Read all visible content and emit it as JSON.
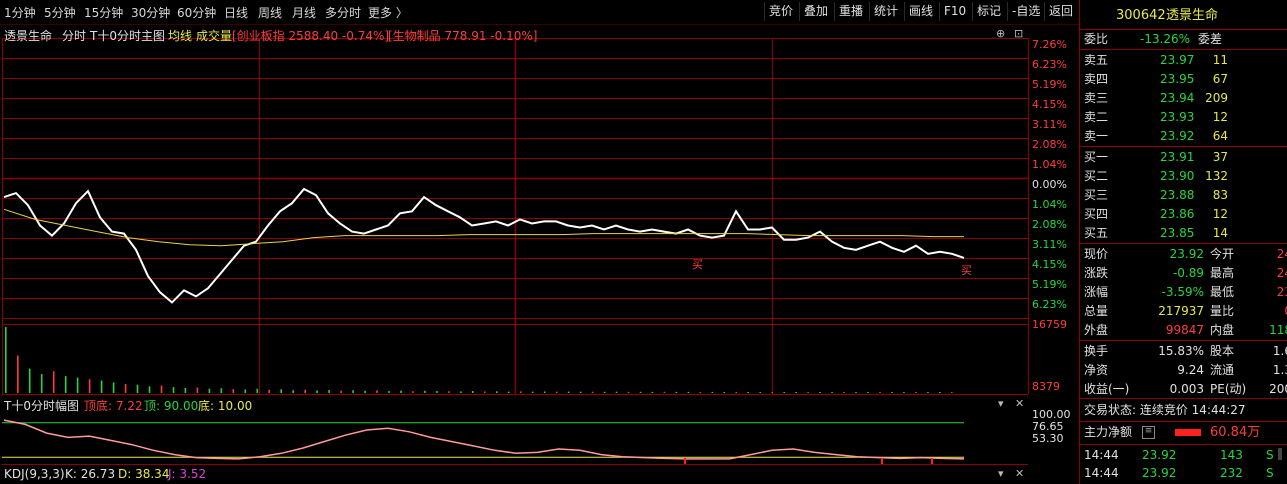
{
  "toolbar": {
    "periods": [
      "1分钟",
      "5分钟",
      "15分钟",
      "30分钟",
      "60分钟",
      "日线",
      "周线",
      "月线",
      "多分时",
      "更多 〉"
    ],
    "buttons": [
      "竞价",
      "叠加",
      "重播",
      "统计",
      "画线",
      "F10",
      "标记",
      "-自选",
      "返回"
    ]
  },
  "header": {
    "stock_name": "透景生命",
    "mode": "分时",
    "sub_mode": "T十0分时主图",
    "avg_label": "均线",
    "vol_label": "成交量",
    "board1": "[创业板指 2588.40 -0.74%]",
    "board2": "[生物制品 778.91 -0.10%]"
  },
  "chart_data": [
    {
      "type": "line",
      "pct_ticks_red": [
        "7.26%",
        "6.23%",
        "5.19%",
        "4.15%",
        "3.11%",
        "2.08%",
        "1.04%"
      ],
      "pct_zero": "0.00%",
      "pct_ticks_green": [
        "1.04%",
        "2.08%",
        "3.11%",
        "4.15%",
        "5.19%",
        "6.23%"
      ],
      "series": [
        {
          "role": "price",
          "values": [
            -0.6,
            -0.4,
            -1.0,
            -2.0,
            -2.5,
            -1.9,
            -0.9,
            -0.3,
            -1.6,
            -2.3,
            -2.4,
            -3.2,
            -4.5,
            -5.3,
            -5.8,
            -5.2,
            -5.5,
            -5.1,
            -4.4,
            -3.7,
            -3.0,
            -2.8,
            -2.0,
            -1.3,
            -0.9,
            -0.2,
            -0.5,
            -1.4,
            -1.9,
            -2.3,
            -2.4,
            -2.2,
            -2.0,
            -1.4,
            -1.3,
            -0.6,
            -1.0,
            -1.3,
            -1.6,
            -2.0,
            -1.9,
            -1.8,
            -2.0,
            -1.7,
            -1.9,
            -1.8,
            -1.8,
            -2.0,
            -2.1,
            -2.0,
            -2.2,
            -2.0,
            -2.2,
            -2.3,
            -2.2,
            -2.3,
            -2.4,
            -2.2,
            -2.5,
            -2.6,
            -2.5,
            -1.3,
            -2.2,
            -2.2,
            -2.1,
            -2.7,
            -2.7,
            -2.6,
            -2.3,
            -2.8,
            -3.1,
            -3.2,
            -3.0,
            -2.8,
            -3.1,
            -3.3,
            -3.0,
            -3.4,
            -3.3,
            -3.4,
            -3.6
          ]
        },
        {
          "role": "avg",
          "values": [
            -1.2,
            -1.7,
            -2.0,
            -2.3,
            -2.6,
            -2.8,
            -2.95,
            -3.0,
            -2.9,
            -2.8,
            -2.6,
            -2.5,
            -2.5,
            -2.5,
            -2.5,
            -2.45,
            -2.45,
            -2.45,
            -2.45,
            -2.4,
            -2.4,
            -2.4,
            -2.4,
            -2.4,
            -2.4,
            -2.45,
            -2.5,
            -2.5,
            -2.5,
            -2.5,
            -2.55,
            -2.55
          ]
        }
      ]
    },
    {
      "type": "bar",
      "ticks": [
        "16759",
        "8379"
      ],
      "values": [
        16759,
        9500,
        6200,
        4800,
        5500,
        4300,
        3900,
        3500,
        3200,
        2700,
        2300,
        2100,
        1700,
        1900,
        1500,
        1300,
        1400,
        1100,
        1200,
        1000,
        900,
        1100,
        800,
        950,
        700,
        850,
        650,
        750,
        600,
        700,
        550,
        650,
        500,
        600,
        450,
        550,
        500,
        450,
        400,
        500,
        380,
        420,
        360,
        400,
        350,
        380,
        330,
        360,
        320,
        340,
        300,
        320,
        290,
        310,
        280,
        300,
        270,
        290,
        260,
        280,
        250,
        270,
        240,
        260,
        230,
        250,
        220,
        240,
        210,
        230,
        200,
        220,
        190,
        210,
        180,
        200,
        170,
        190,
        160,
        180
      ]
    },
    {
      "type": "line",
      "title": "T十0分时幅图",
      "legend_top_bottom": "顶底: 7.22",
      "legend_top": "顶: 90.00",
      "legend_bottom": "底: 10.00",
      "ticks": [
        "100.00",
        "76.65",
        "53.30"
      ],
      "series": [
        {
          "role": "osc",
          "values": [
            95,
            85,
            65,
            55,
            58,
            48,
            38,
            25,
            15,
            8,
            6,
            5,
            10,
            18,
            30,
            45,
            60,
            72,
            76,
            68,
            55,
            45,
            35,
            25,
            18,
            20,
            28,
            25,
            15,
            10,
            8,
            6,
            5,
            5,
            5,
            15,
            25,
            28,
            20,
            15,
            10,
            8,
            6,
            8,
            6,
            5
          ]
        }
      ]
    },
    {
      "type": "line",
      "title": "KDJ(9,3,3)",
      "k": "K: 26.73",
      "d": "D: 38.34",
      "j": "J: 3.52"
    }
  ],
  "panel": {
    "code": "300642",
    "name": "透景生命",
    "weibi_label": "委比",
    "weibi": "-13.26%",
    "weicha_label": "委差",
    "asks": [
      {
        "label": "卖五",
        "price": "23.97",
        "vol": "11"
      },
      {
        "label": "卖四",
        "price": "23.95",
        "vol": "67"
      },
      {
        "label": "卖三",
        "price": "23.94",
        "vol": "209"
      },
      {
        "label": "卖二",
        "price": "23.93",
        "vol": "12"
      },
      {
        "label": "卖一",
        "price": "23.92",
        "vol": "64"
      }
    ],
    "bids": [
      {
        "label": "买一",
        "price": "23.91",
        "vol": "37"
      },
      {
        "label": "买二",
        "price": "23.90",
        "vol": "132"
      },
      {
        "label": "买三",
        "price": "23.88",
        "vol": "83"
      },
      {
        "label": "买四",
        "price": "23.86",
        "vol": "12"
      },
      {
        "label": "买五",
        "price": "23.85",
        "vol": "14"
      }
    ],
    "stats": [
      {
        "l1": "现价",
        "v1": "23.92",
        "l2": "今开",
        "v2": "24"
      },
      {
        "l1": "涨跌",
        "v1": "-0.89",
        "l2": "最高",
        "v2": "24"
      },
      {
        "l1": "涨幅",
        "v1": "-3.59%",
        "l2": "最低",
        "v2": "23"
      },
      {
        "l1": "总量",
        "v1": "217937",
        "l2": "量比",
        "v2": "0"
      },
      {
        "l1": "外盘",
        "v1": "99847",
        "l2": "内盘",
        "v2": "118"
      }
    ],
    "stats2": [
      {
        "l1": "换手",
        "v1": "15.83%",
        "l2": "股本",
        "v2": "1.6"
      },
      {
        "l1": "净资",
        "v1": "9.24",
        "l2": "流通",
        "v2": "1.3"
      },
      {
        "l1": "收益(一)",
        "v1": "0.003",
        "l2": "PE(动)",
        "v2": "200"
      }
    ],
    "trade_status": "交易状态: 连续竞价 14:44:27",
    "main_flow_label": "主力净额",
    "main_flow_value": "60.84万",
    "ticks": [
      {
        "time": "14:44",
        "price": "23.92",
        "vol": "143",
        "side": "S"
      },
      {
        "time": "14:44",
        "price": "23.92",
        "vol": "232",
        "side": "S"
      }
    ]
  },
  "marker_text": "买",
  "colors": {
    "grid": "#8b0000",
    "price": "#ffffff",
    "avg": "#e8d24a",
    "up": "#ff3c3c",
    "down": "#27d53c",
    "accent": "#e8e84a"
  }
}
